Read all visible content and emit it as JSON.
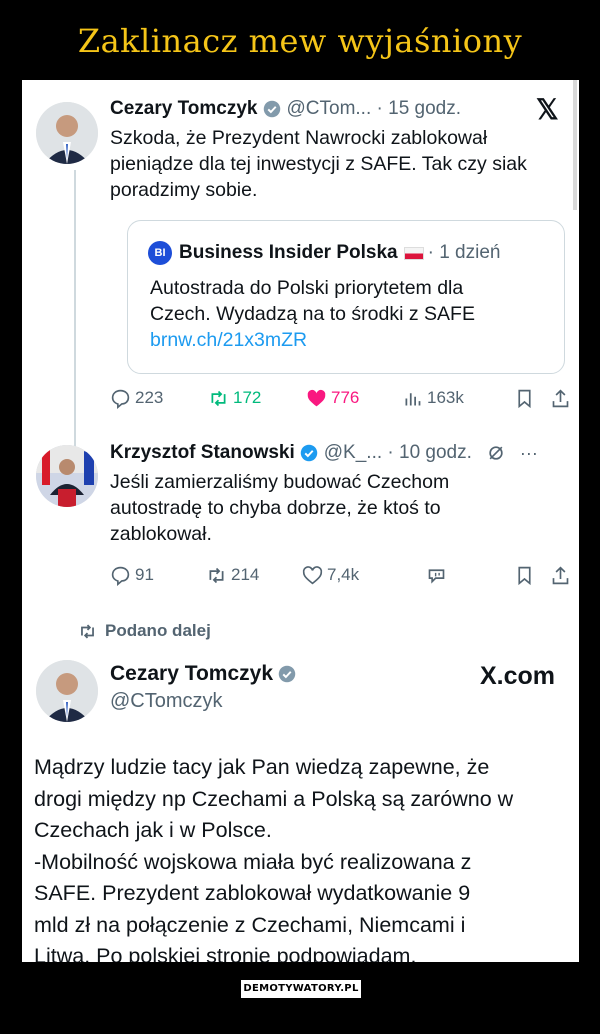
{
  "page": {
    "title": "Zaklinacz mew wyjaśniony",
    "watermark": "DEMOTYWATORY.PL"
  },
  "tweet1": {
    "name": "Cezary Tomczyk",
    "handle_time": "@CTom... · 15 godz.",
    "text_lines": [
      "Szkoda, że Prezydent Nawrocki zablokował",
      "pieniądze dla tej inwestycji z SAFE. Tak czy siak",
      "poradzimy sobie."
    ],
    "quote": {
      "badge": "BI",
      "source": "Business Insider Polska",
      "age": "· 1 dzień",
      "lines": [
        "Autostrada do Polski priorytetem dla",
        "Czech. Wydadzą na to środki z SAFE"
      ],
      "link": "brnw.ch/21x3mZR"
    },
    "stats": {
      "replies": "223",
      "reposts": "172",
      "likes": "776",
      "views": "163k"
    }
  },
  "tweet2": {
    "name": "Krzysztof Stanowski",
    "handle_time": "@K_... · 10 godz.",
    "text_lines": [
      "Jeśli zamierzaliśmy budować Czechom",
      "autostradę to chyba dobrze, że ktoś to",
      "zablokował."
    ],
    "stats": {
      "replies": "91",
      "reposts": "214",
      "likes": "7,4k"
    }
  },
  "repost": {
    "label": "Podano dalej"
  },
  "tweet3": {
    "name": "Cezary Tomczyk",
    "handle": "@CTomczyk",
    "brand": "X.com",
    "body_lines": [
      "Mądrzy ludzie tacy jak Pan wiedzą zapewne, że",
      "drogi między np Czechami a Polską są zarówno w",
      "Czechach jak i w Polsce.",
      "-Mobilność wojskowa miała być realizowana z",
      "SAFE. Prezydent zablokował wydatkowanie 9",
      "mld zł na połączenie z Czechami, Niemcami i",
      "Litwą. Po polskiej stronie podpowiadam."
    ]
  },
  "colors": {
    "title": "#f5c518",
    "link": "#1d9bf0",
    "like": "#f91880",
    "repost": "#00ba7c",
    "verified": "#1d9bf0"
  }
}
